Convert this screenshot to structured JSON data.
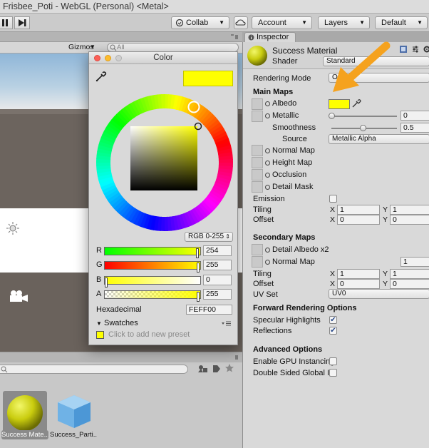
{
  "window": {
    "title": "Frisbee_Poti - WebGL (Personal) <Metal>"
  },
  "toolbar": {
    "collab": "Collab",
    "account": "Account",
    "layers": "Layers",
    "layout": "Default"
  },
  "scene": {
    "gizmos": "Gizmos",
    "search_placeholder": "All"
  },
  "project": {
    "assets": [
      {
        "label": "Success Mate...",
        "selected": true
      },
      {
        "label": "Success_Parti...",
        "selected": false
      }
    ]
  },
  "color_picker": {
    "title": "Color",
    "mode": "RGB 0-255",
    "channels": [
      {
        "label": "R",
        "value": "254"
      },
      {
        "label": "G",
        "value": "255"
      },
      {
        "label": "B",
        "value": "0"
      },
      {
        "label": "A",
        "value": "255"
      }
    ],
    "hex_label": "Hexadecimal",
    "hex_value": "FEFF00",
    "swatches_label": "Swatches",
    "add_preset": "Click to add new preset",
    "color": "#FEFF00"
  },
  "inspector": {
    "tab": "Inspector",
    "material_name": "Success Material",
    "shader_label": "Shader",
    "shader_value": "Standard",
    "rendering_mode_label": "Rendering Mode",
    "rendering_mode_value": "Op",
    "main_maps": "Main Maps",
    "albedo": "Albedo",
    "metallic": "Metallic",
    "metallic_value": "0",
    "smoothness": "Smoothness",
    "smoothness_value": "0.5",
    "source_label": "Source",
    "source_value": "Metallic Alpha",
    "normal_map": "Normal Map",
    "height_map": "Height Map",
    "occlusion": "Occlusion",
    "detail_mask": "Detail Mask",
    "emission": "Emission",
    "tiling": "Tiling",
    "offset": "Offset",
    "tiling_x": "1",
    "tiling_y": "1",
    "offset_x": "0",
    "offset_y": "0",
    "secondary_maps": "Secondary Maps",
    "detail_albedo": "Detail Albedo x2",
    "normal_map2": "Normal Map",
    "normal_map2_value": "1",
    "tiling2_x": "1",
    "tiling2_y": "1",
    "offset2_x": "0",
    "offset2_y": "0",
    "uv_set_label": "UV Set",
    "uv_set_value": "UV0",
    "forward_options": "Forward Rendering Options",
    "specular": "Specular Highlights",
    "reflections": "Reflections",
    "advanced": "Advanced Options",
    "gpu_instancing": "Enable GPU Instancing",
    "double_sided": "Double Sided Global Il",
    "x_label": "X",
    "y_label": "Y"
  },
  "colors": {
    "albedo": "#FEFF00",
    "arrow": "#F5A21E"
  }
}
